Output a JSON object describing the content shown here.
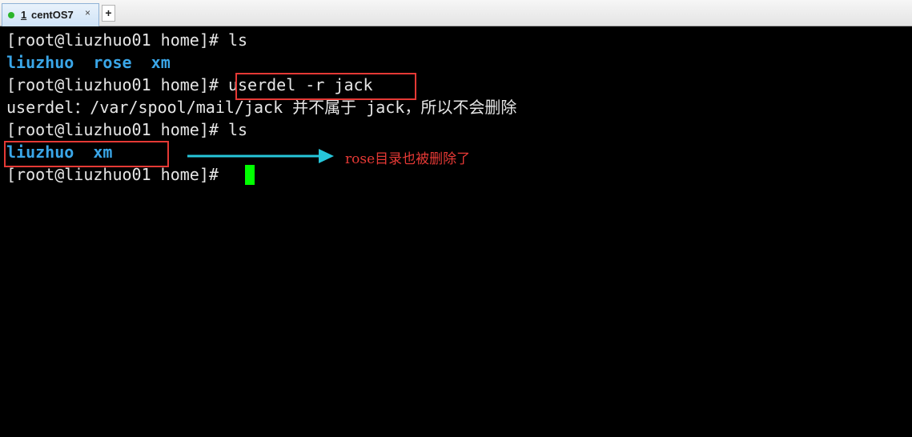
{
  "tabs": [
    {
      "index": "1",
      "name": "centOS7",
      "close_label": "×"
    }
  ],
  "new_tab_label": "+",
  "terminal": {
    "line1": {
      "prompt": "[root@liuzhuo01 home]#",
      "command": " ls"
    },
    "line2": {
      "items": [
        "liuzhuo",
        "rose",
        "xm"
      ]
    },
    "line3": {
      "prompt": "[root@liuzhuo01 home]#",
      "command": " userdel -r jack"
    },
    "line4": {
      "text": "userdel：/var/spool/mail/jack 并不属于 jack，所以不会删除"
    },
    "line5": {
      "prompt": "[root@liuzhuo01 home]#",
      "command": " ls"
    },
    "line6": {
      "items": [
        "liuzhuo",
        "xm"
      ]
    },
    "line7": {
      "prompt": "[root@liuzhuo01 home]#",
      "command": " "
    }
  },
  "annotation": {
    "text": "rose目录也被删除了"
  },
  "colors": {
    "terminal_bg": "#000000",
    "text": "#e6e6e6",
    "directory": "#3aa6e8",
    "cursor": "#00ff00",
    "highlight_box": "#e53935",
    "arrow": "#26c6da"
  }
}
